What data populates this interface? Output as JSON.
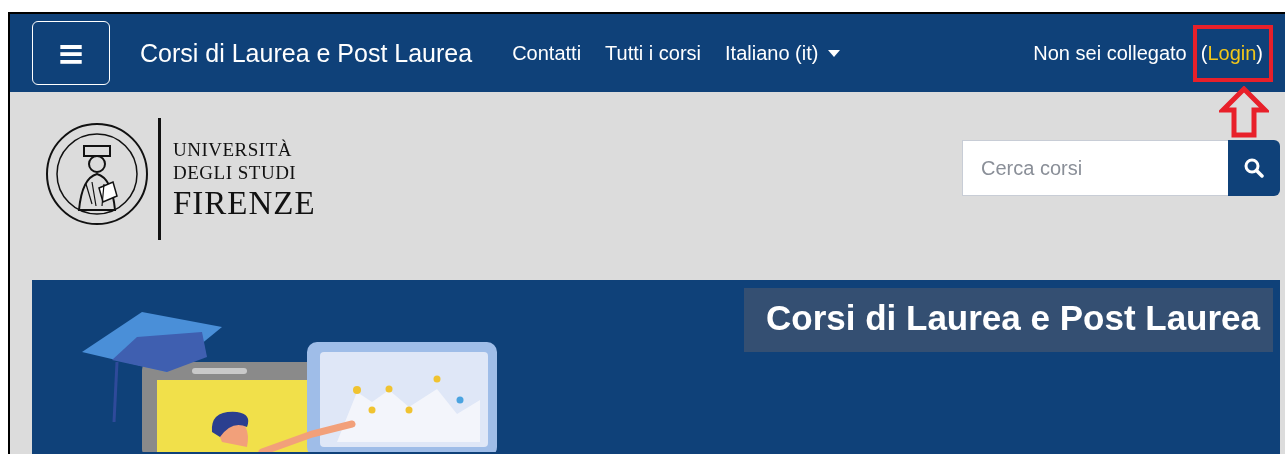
{
  "navbar": {
    "menu_button": "≡",
    "site_title": "Corsi di Laurea e Post Laurea",
    "links": [
      {
        "label": "Contatti",
        "kind": "link"
      },
      {
        "label": "Tutti i corsi",
        "kind": "link"
      },
      {
        "label": "Italiano (it)",
        "kind": "dropdown"
      }
    ],
    "login_status": {
      "text": "Non sei collegato",
      "open": "(",
      "link": "Login",
      "close": ")"
    }
  },
  "logo": {
    "lines": [
      "UNIVERSITÀ",
      "DEGLI STUDI",
      "FIRENZE"
    ]
  },
  "search": {
    "placeholder": "Cerca corsi"
  },
  "banner": {
    "title": "Corsi di Laurea e Post Laurea"
  }
}
